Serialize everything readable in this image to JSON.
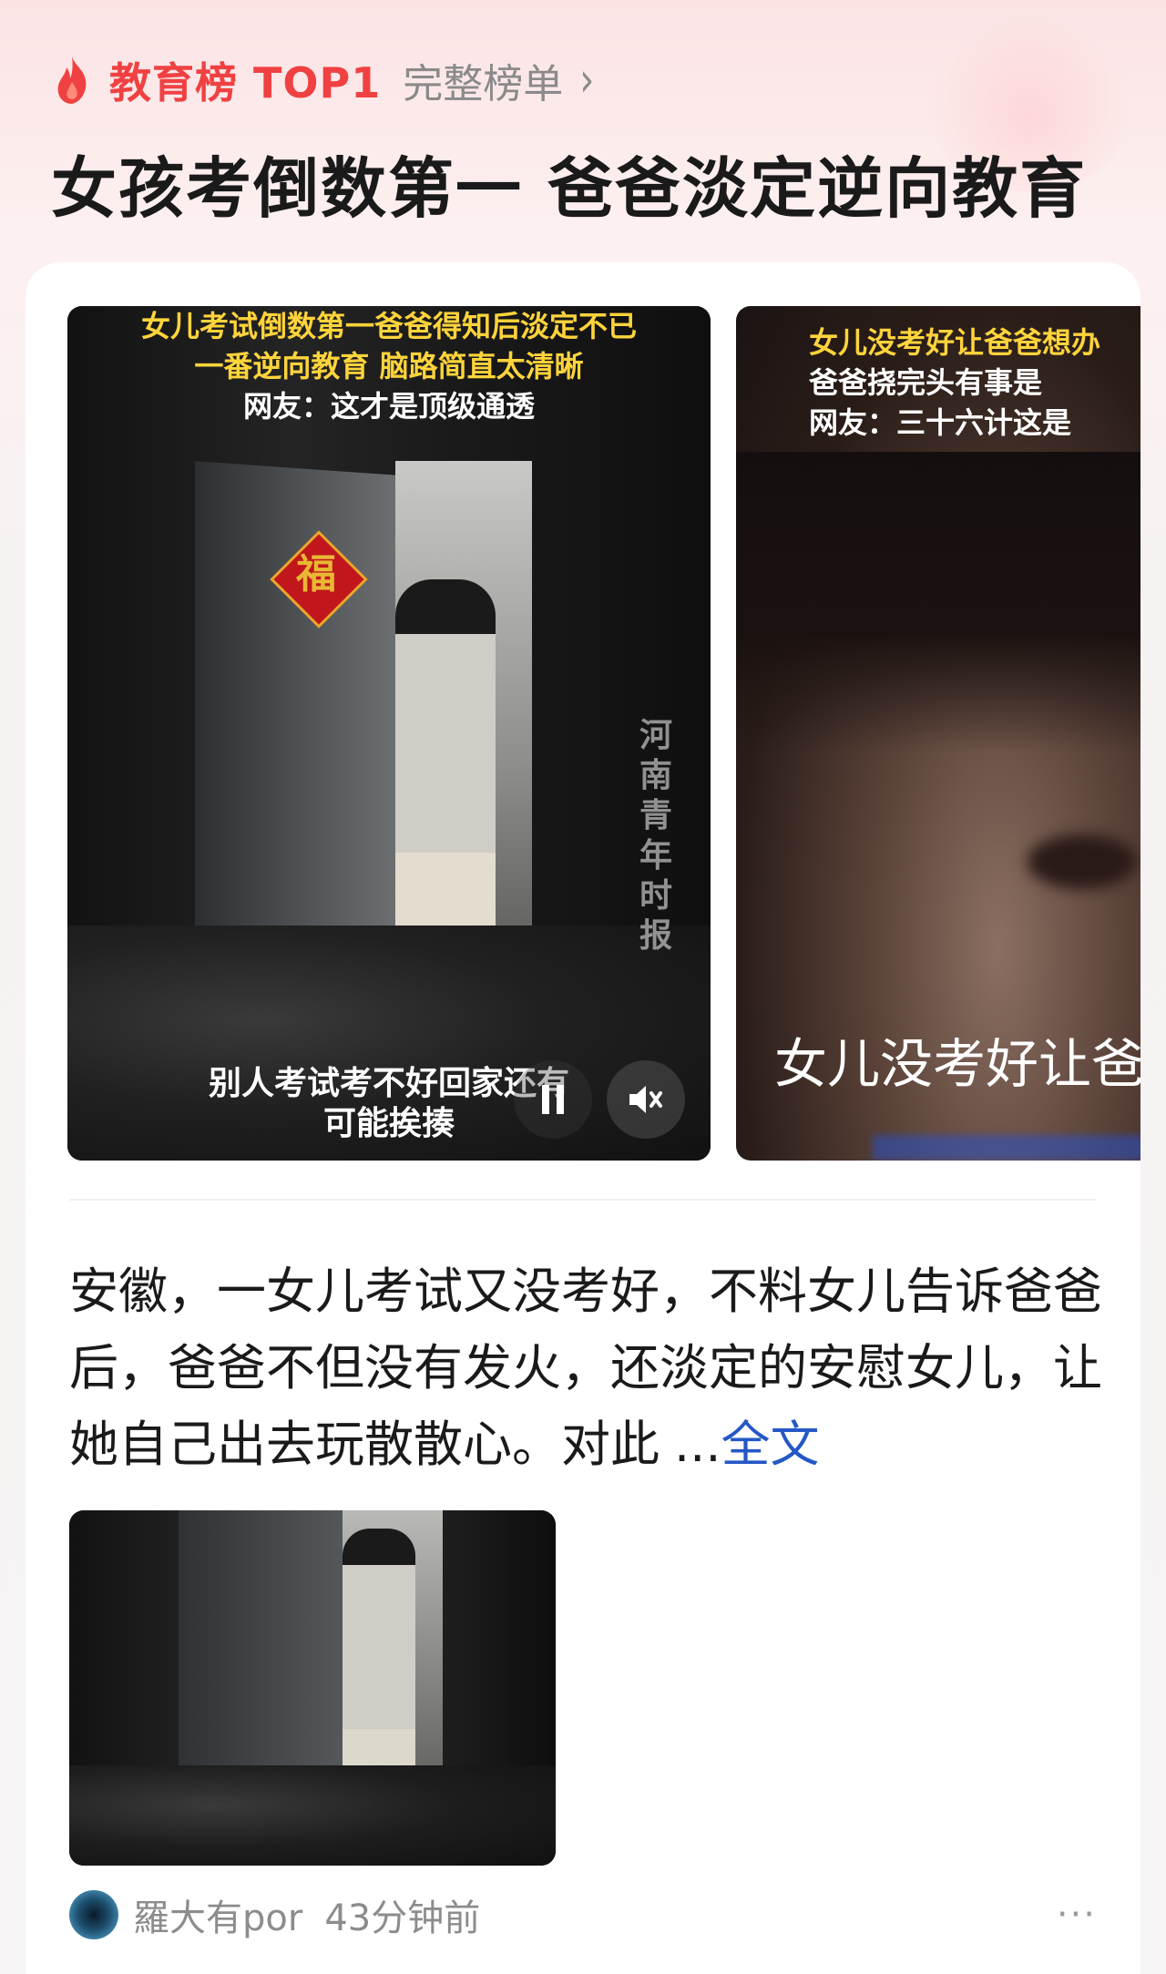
{
  "hot_list": {
    "label": "教育榜 TOP1",
    "link": "完整榜单",
    "headline": "女孩考倒数第一 爸爸淡定逆向教育"
  },
  "media": {
    "video1": {
      "overlay_line1": "女儿考试倒数第一爸爸得知后淡定不已",
      "overlay_line2": "一番逆向教育 脑路简直太清晰",
      "overlay_line3": "网友：这才是顶级通透",
      "watermark": "河南青年时报",
      "subtitle_line1": "别人考试考不好回家还有",
      "subtitle_line2": "可能挨揍",
      "fu_char": "福"
    },
    "video2": {
      "overlay_line1": "女儿没考好让爸爸想办",
      "overlay_line2": "爸爸挠完头有事是",
      "overlay_line3": "网友：三十六计这是",
      "caption": "女儿没考好让爸爸"
    }
  },
  "article": {
    "text": "安徽，一女儿考试又没考好，不料女儿告诉爸爸后，爸爸不但没有发火，还淡定的安慰女儿，让她自己出去玩散散心。对此",
    "more": "...",
    "full_link": "全文"
  },
  "meta": {
    "author": "羅大有por",
    "time": "43分钟前",
    "more_symbol": "···"
  },
  "icons": {
    "flame": "flame-icon",
    "chevron": "chevron-right-icon",
    "pause": "pause-icon",
    "mute": "mute-icon",
    "more": "more-icon"
  },
  "colors": {
    "accent_red": "#f04142",
    "link_blue": "#2458c6",
    "overlay_yellow": "#ffd43b"
  }
}
